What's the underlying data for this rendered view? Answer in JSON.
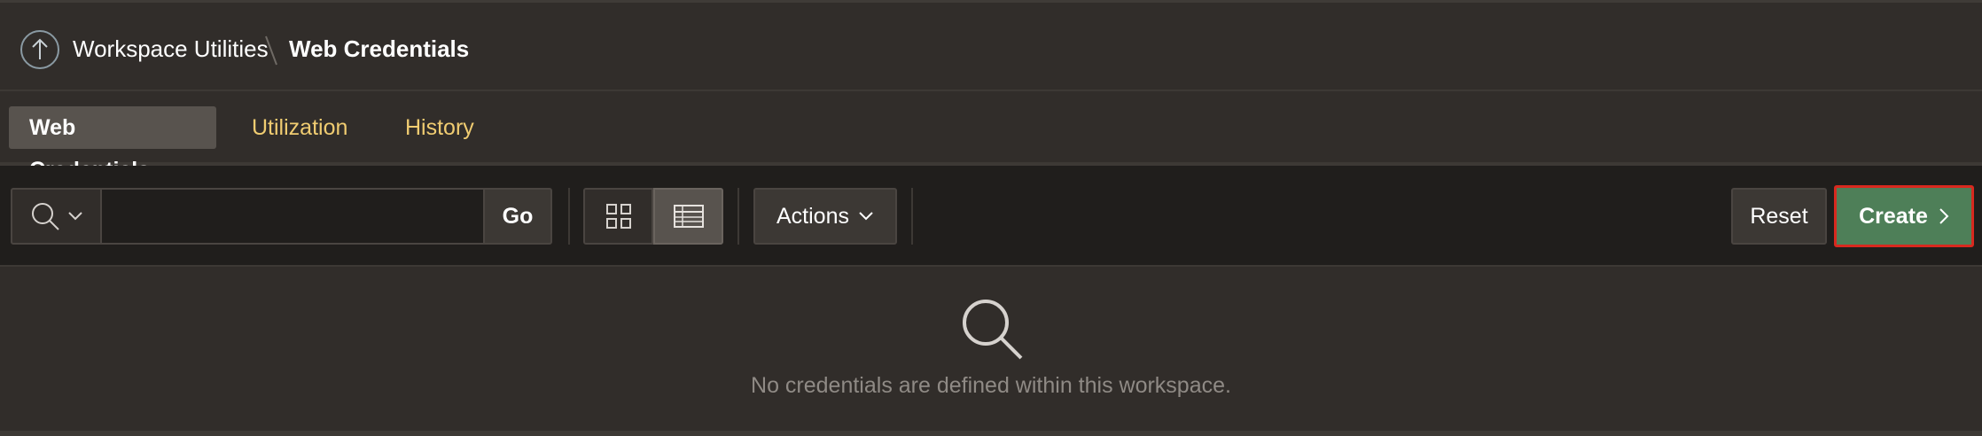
{
  "breadcrumb": {
    "up_icon": "arrow-up-circle-icon",
    "parent_label": "Workspace Utilities",
    "current_label": "Web Credentials"
  },
  "tabs": [
    {
      "label": "Web Credentials",
      "active": true
    },
    {
      "label": "Utilization",
      "active": false
    },
    {
      "label": "History",
      "active": false
    }
  ],
  "toolbar": {
    "search_icon": "search-icon",
    "search_value": "",
    "go_label": "Go",
    "view_grid_icon": "grid-view-icon",
    "view_report_icon": "report-view-icon",
    "actions_label": "Actions",
    "reset_label": "Reset",
    "create_label": "Create"
  },
  "empty_state": {
    "icon": "search-icon",
    "message": "No credentials are defined within this workspace."
  },
  "colors": {
    "background": "#312d2a",
    "toolbar_background": "#201e1c",
    "tab_link": "#f0cc71",
    "create_button": "#4e7f58",
    "highlight_border": "#d8291f"
  }
}
